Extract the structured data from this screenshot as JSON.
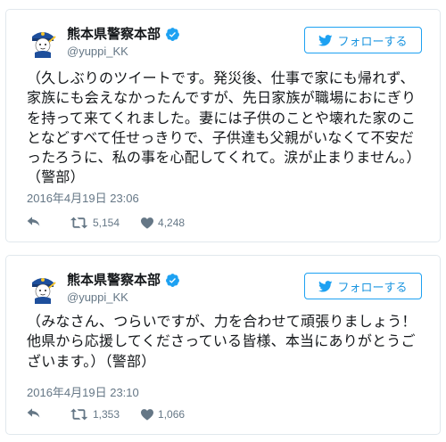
{
  "tweets": [
    {
      "display_name": "熊本県警察本部",
      "handle": "@yuppi_KK",
      "follow_label": "フォローする",
      "text": "（久しぶりのツイートです。発災後、仕事で家にも帰れず、家族にも会えなかったんですが、先日家族が職場におにぎりを持って来てくれました。妻には子供のことや壊れた家のことなどすべて任せっきりで、子供達も父親がいなくて不安だったろうに、私の事を心配してくれて。涙が止まりません。）（警部）",
      "timestamp": "2016年4月19日 23:06",
      "retweets": "5,154",
      "likes": "4,248"
    },
    {
      "display_name": "熊本県警察本部",
      "handle": "@yuppi_KK",
      "follow_label": "フォローする",
      "text": "（みなさん、つらいですが、力を合わせて頑張りましょう！他県から応援してくださっている皆様、本当にありがとうございます。）（警部）",
      "timestamp": "2016年4月19日 23:10",
      "retweets": "1,353",
      "likes": "1,066"
    }
  ],
  "icons": {
    "avatar": "police-mascot-avatar",
    "verified": "verified-badge-icon",
    "follow": "twitter-bird-icon",
    "reply": "reply-icon",
    "retweet": "retweet-icon",
    "like": "heart-icon"
  },
  "colors": {
    "accent": "#1da1f2",
    "text": "#14171a",
    "muted": "#657786",
    "border": "#e1e8ed"
  }
}
